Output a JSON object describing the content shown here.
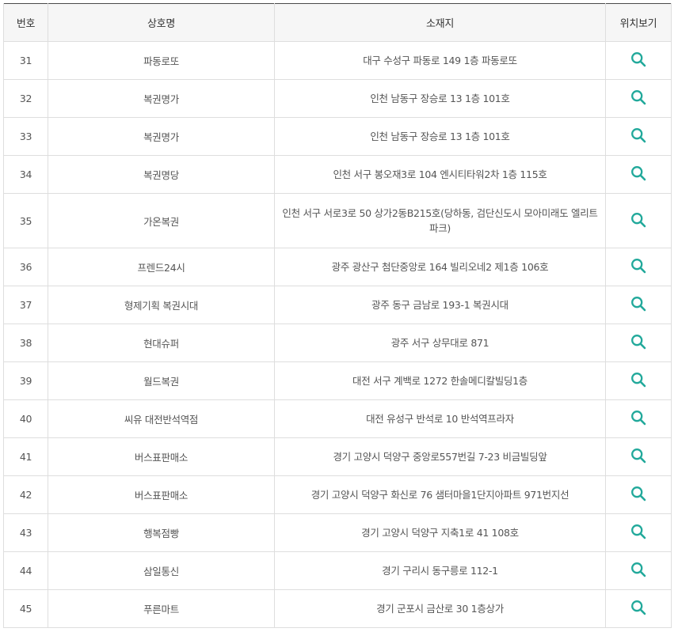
{
  "headers": {
    "no": "번호",
    "name": "상호명",
    "address": "소재지",
    "location": "위치보기"
  },
  "icons": {
    "row_action": "search-icon"
  },
  "colors": {
    "accent": "#22a99b",
    "header_bg": "#f6f6f6"
  },
  "rows": [
    {
      "no": "31",
      "name": "파동로또",
      "address": "대구 수성구 파동로 149 1층 파동로또"
    },
    {
      "no": "32",
      "name": "복권명가",
      "address": "인천 남동구 장승로 13 1층 101호"
    },
    {
      "no": "33",
      "name": "복권명가",
      "address": "인천 남동구 장승로 13 1층 101호"
    },
    {
      "no": "34",
      "name": "복권명당",
      "address": "인천 서구 봉오재3로 104 엔시티타워2차 1층 115호"
    },
    {
      "no": "35",
      "name": "가온복권",
      "address": "인천 서구 서로3로 50 상가2동B215호(당하동, 검단신도시 모아미래도 엘리트파크)"
    },
    {
      "no": "36",
      "name": "프렌드24시",
      "address": "광주 광산구 첨단중앙로 164 빌리오네2 제1층 106호"
    },
    {
      "no": "37",
      "name": "형제기획 복권시대",
      "address": "광주 동구 금남로 193-1 복권시대"
    },
    {
      "no": "38",
      "name": "현대슈퍼",
      "address": "광주 서구 상무대로 871"
    },
    {
      "no": "39",
      "name": "월드복권",
      "address": "대전 서구 계백로 1272 한솔메디칼빌딩1층"
    },
    {
      "no": "40",
      "name": "씨유 대전반석역점",
      "address": "대전 유성구 반석로 10 반석역프라자"
    },
    {
      "no": "41",
      "name": "버스표판매소",
      "address": "경기 고양시 덕양구 중앙로557번길 7-23 비금빌딩앞"
    },
    {
      "no": "42",
      "name": "버스표판매소",
      "address": "경기 고양시 덕양구 화신로 76 샘터마을1단지아파트 971번지선"
    },
    {
      "no": "43",
      "name": "행복점빵",
      "address": "경기 고양시 덕양구 지축1로 41 108호"
    },
    {
      "no": "44",
      "name": "삼일통신",
      "address": "경기 구리시 동구릉로 112-1"
    },
    {
      "no": "45",
      "name": "푸른마트",
      "address": "경기 군포시 금산로 30 1층상가"
    }
  ]
}
